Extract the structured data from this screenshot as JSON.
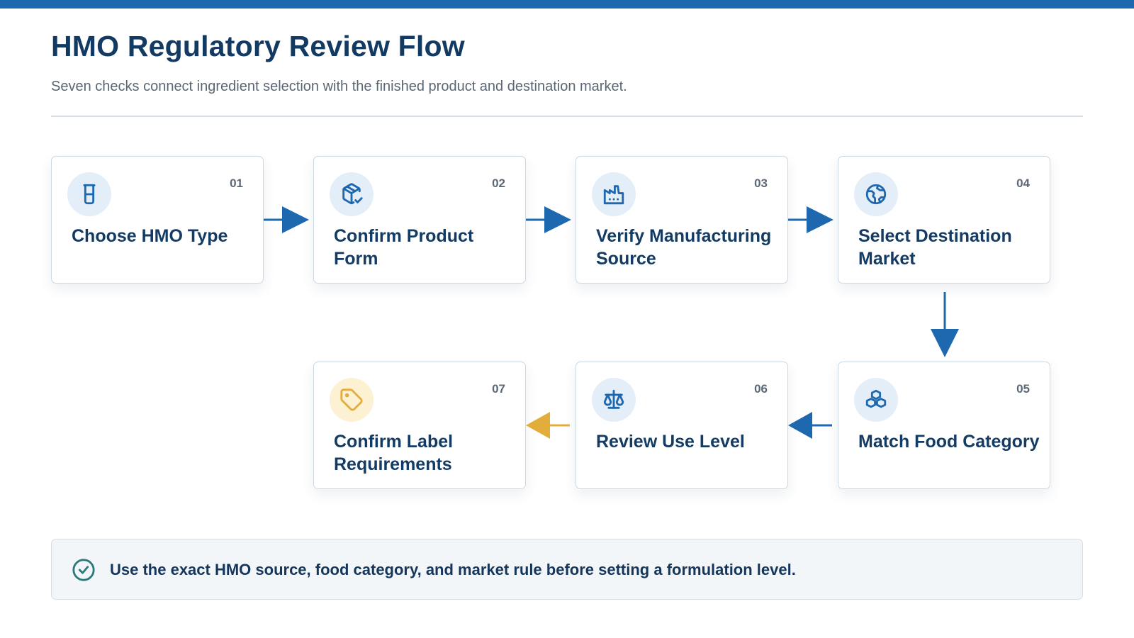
{
  "header": {
    "title": "HMO Regulatory Review Flow",
    "subtitle": "Seven checks connect ingredient selection with the finished product and destination market."
  },
  "steps": [
    {
      "number": "01",
      "label": "Choose HMO Type",
      "icon": "beaker-icon"
    },
    {
      "number": "02",
      "label": "Confirm Product Form",
      "icon": "package-check-icon"
    },
    {
      "number": "03",
      "label": "Verify Manufacturing Source",
      "icon": "factory-icon"
    },
    {
      "number": "04",
      "label": "Select Destination Market",
      "icon": "globe-icon"
    },
    {
      "number": "05",
      "label": "Match Food Category",
      "icon": "blocks-icon"
    },
    {
      "number": "06",
      "label": "Review Use Level",
      "icon": "scale-icon"
    },
    {
      "number": "07",
      "label": "Confirm Label Requirements",
      "icon": "tag-icon"
    }
  ],
  "note": {
    "icon": "check-circle-icon",
    "text": "Use the exact HMO source, food category, and market rule before setting a formulation level."
  },
  "colors": {
    "primary": "#1d68ae",
    "accent": "#e2ad3b",
    "title": "#133a62",
    "icon_bg": "#e3eef9",
    "accent_icon_bg": "#fcf1d2",
    "note_icon": "#2b7a7a"
  }
}
